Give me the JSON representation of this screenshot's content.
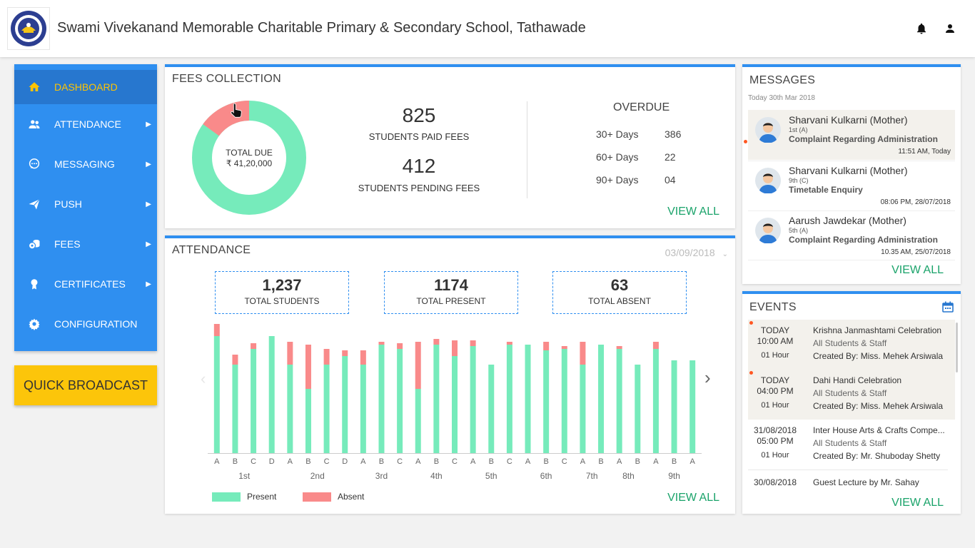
{
  "header": {
    "school_name": "Swami Vivekanand Memorable Charitable Primary & Secondary School, Tathawade",
    "icons": [
      "bell-icon",
      "user-icon"
    ]
  },
  "sidebar": {
    "items": [
      {
        "label": "DASHBOARD",
        "icon": "home-icon",
        "active": true
      },
      {
        "label": "ATTENDANCE",
        "icon": "users-icon",
        "active": false
      },
      {
        "label": "MESSAGING",
        "icon": "chat-icon",
        "active": false
      },
      {
        "label": "PUSH",
        "icon": "send-icon",
        "active": false
      },
      {
        "label": "FEES",
        "icon": "coins-icon",
        "active": false
      },
      {
        "label": "CERTIFICATES",
        "icon": "award-icon",
        "active": false
      },
      {
        "label": "CONFIGURATION",
        "icon": "gear-icon",
        "active": false
      }
    ],
    "accent": "#ffc400"
  },
  "quick_broadcast": "QUICK BROADCAST",
  "fees": {
    "title": "FEES COLLECTION",
    "total_due_label": "TOTAL DUE",
    "total_due_value": "₹ 41,20,000",
    "paid_count": "825",
    "paid_label": "STUDENTS PAID FEES",
    "pending_count": "412",
    "pending_label": "STUDENTS PENDING FEES",
    "overdue_title": "OVERDUE",
    "overdue": [
      {
        "label": "30+ Days",
        "value": "386"
      },
      {
        "label": "60+ Days",
        "value": "22"
      },
      {
        "label": "90+ Days",
        "value": "04"
      }
    ],
    "view_all": "VIEW ALL",
    "donut": {
      "paid_fraction": 0.85,
      "paid_color": "#76ebbb",
      "due_color": "#f98a8a"
    }
  },
  "attendance": {
    "title": "ATTENDANCE",
    "date": "03/09/2018",
    "stats": [
      {
        "value": "1,237",
        "label": "TOTAL STUDENTS"
      },
      {
        "value": "1174",
        "label": "TOTAL PRESENT"
      },
      {
        "value": "63",
        "label": "TOTAL ABSENT"
      }
    ],
    "legend_present": "Present",
    "legend_absent": "Absent",
    "view_all": "VIEW ALL"
  },
  "chart_data": {
    "type": "bar",
    "stacked": true,
    "categories": [
      "A",
      "B",
      "C",
      "D",
      "A",
      "B",
      "C",
      "D",
      "A",
      "B",
      "C",
      "A",
      "B",
      "C",
      "A",
      "B",
      "C",
      "A",
      "B",
      "C",
      "A",
      "B",
      "A",
      "B",
      "A",
      "B",
      "A"
    ],
    "groups": [
      {
        "label": "1st",
        "span": 4
      },
      {
        "label": "2nd",
        "span": 4
      },
      {
        "label": "3rd",
        "span": 3
      },
      {
        "label": "4th",
        "span": 3
      },
      {
        "label": "5th",
        "span": 3
      },
      {
        "label": "6th",
        "span": 3
      },
      {
        "label": "7th",
        "span": 2
      },
      {
        "label": "8th",
        "span": 2
      },
      {
        "label": "9th",
        "span": 3
      }
    ],
    "series": [
      {
        "name": "Present",
        "color": "#76ebbb",
        "values": [
          164,
          124,
          146,
          164,
          124,
          90,
          124,
          136,
          124,
          152,
          146,
          90,
          152,
          136,
          150,
          124,
          152,
          152,
          144,
          146,
          124,
          152,
          146,
          124,
          146,
          130,
          130
        ]
      },
      {
        "name": "Absent",
        "color": "#f98a8a",
        "values": [
          26,
          14,
          8,
          0,
          32,
          62,
          22,
          8,
          20,
          4,
          8,
          66,
          8,
          22,
          8,
          0,
          4,
          0,
          12,
          4,
          32,
          0,
          4,
          0,
          10,
          0,
          0
        ]
      }
    ],
    "ylim": [
      0,
      170
    ],
    "grid": false,
    "legend": "bottom-left"
  },
  "messages": {
    "title": "MESSAGES",
    "date_label": "Today 30th Mar 2018",
    "items": [
      {
        "name": "Sharvani Kulkarni (Mother)",
        "class": "1st (A)",
        "subject": "Complaint Regarding Administration",
        "time": "11:51 AM, Today",
        "unread": true
      },
      {
        "name": "Sharvani Kulkarni (Mother)",
        "class": "9th (C)",
        "subject": "Timetable Enquiry",
        "time": "08:06 PM,  28/07/2018",
        "unread": false
      },
      {
        "name": "Aarush Jawdekar (Mother)",
        "class": "5th (A)",
        "subject": "Complaint Regarding Administration",
        "time": "10.35 AM,  25/07/2018",
        "unread": false
      }
    ],
    "view_all": "VIEW ALL"
  },
  "events": {
    "title": "EVENTS",
    "items": [
      {
        "date": "TODAY",
        "time": "10:00 AM",
        "duration": "01 Hour",
        "title": "Krishna Janmashtami Celebration",
        "audience": "All Students & Staff",
        "creator": "Created By: Miss. Mehek Arsiwala",
        "highlight": true
      },
      {
        "date": "TODAY",
        "time": "04:00 PM",
        "duration": "01 Hour",
        "title": "Dahi Handi Celebration",
        "audience": "All Students & Staff",
        "creator": "Created By: Miss. Mehek Arsiwala",
        "highlight": true
      },
      {
        "date": "31/08/2018",
        "time": "05:00 PM",
        "duration": "01 Hour",
        "title": "Inter House Arts & Crafts Compe...",
        "audience": "All Students & Staff",
        "creator": "Created By: Mr. Shuboday Shetty",
        "highlight": false
      },
      {
        "date": "30/08/2018",
        "time": "",
        "duration": "",
        "title": "Guest Lecture by Mr. Sahay",
        "audience": "",
        "creator": "",
        "highlight": false
      }
    ],
    "view_all": "VIEW ALL"
  }
}
